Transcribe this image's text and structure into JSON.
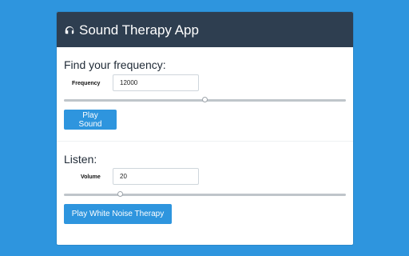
{
  "app": {
    "title": "Sound Therapy App",
    "icon": "headphones-icon"
  },
  "frequency_section": {
    "heading": "Find your frequency:",
    "label": "Frequency",
    "value": "12000",
    "slider_fraction": 0.5,
    "button_label": "Play Sound"
  },
  "listen_section": {
    "heading": "Listen:",
    "label": "Volume",
    "value": "20",
    "slider_fraction": 0.2,
    "button_label": "Play White Noise Therapy"
  },
  "colors": {
    "background": "#2e95de",
    "header": "#2e3e50",
    "button": "#2e95de"
  }
}
